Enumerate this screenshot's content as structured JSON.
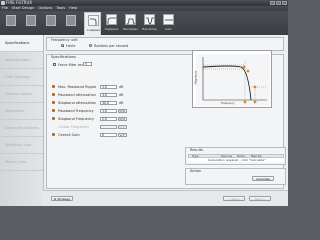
{
  "window": {
    "title": "FIRE FILTRUX"
  },
  "menubar": {
    "items": [
      "File",
      "Start Design",
      "Options",
      "Tools",
      "Help"
    ]
  },
  "toolbar": {
    "buttons": [
      {
        "label": ""
      },
      {
        "label": ""
      },
      {
        "label": ""
      },
      {
        "label": ""
      }
    ],
    "tabs": [
      {
        "label": "Lowpass"
      },
      {
        "label": "Highpass"
      },
      {
        "label": "Bandpass"
      },
      {
        "label": "Bandstop"
      },
      {
        "label": "Gain"
      }
    ]
  },
  "sidebar": {
    "items": [
      {
        "label": "Specifications"
      },
      {
        "label": "Approximation"
      },
      {
        "label": "Filter Topology"
      },
      {
        "label": "Element Values"
      },
      {
        "label": "Responses"
      },
      {
        "label": "Sensitivity Analysis"
      },
      {
        "label": "Statistical Anal."
      },
      {
        "label": "Monte Carlo"
      }
    ]
  },
  "frequency_unit": {
    "title": "Frequency unit",
    "option_hertz": "Hertz",
    "option_rad": "Radians per second"
  },
  "specifications": {
    "title": "Specifications",
    "force_filter_order_label": "Force filter order",
    "force_filter_order_value": "3",
    "rows": [
      {
        "label": "Max. Passband Ripple",
        "value": "1.0",
        "unit": "dB"
      },
      {
        "label": "Passband attenuation",
        "value": "3.0",
        "unit": "dB"
      },
      {
        "label": "Stopband attenuation",
        "value": "30.0",
        "unit": "dB"
      },
      {
        "label": "Passband Frequency",
        "value": "1.0",
        "unit": "kHz"
      },
      {
        "label": "Stopband Frequency",
        "value": "2.0",
        "unit": "kHz"
      },
      {
        "label": "Center Frequency",
        "value": "",
        "unit": "kHz"
      },
      {
        "label": "Overall Gain",
        "value": "0",
        "unit": "V/V"
      }
    ]
  },
  "graph": {
    "xlabel": "Frequency",
    "ylabel": "Magnitude"
  },
  "results": {
    "title": "Results",
    "columns": [
      "Type",
      "Sources",
      "Order",
      "Max Dp"
    ],
    "message": "Calculation required - click \"Calculate\""
  },
  "action": {
    "title": "Action",
    "calculate_label": "Calculate"
  },
  "footer": {
    "strategy_label": "Strategy",
    "back_label": "< Back",
    "next_label": "Next >"
  }
}
